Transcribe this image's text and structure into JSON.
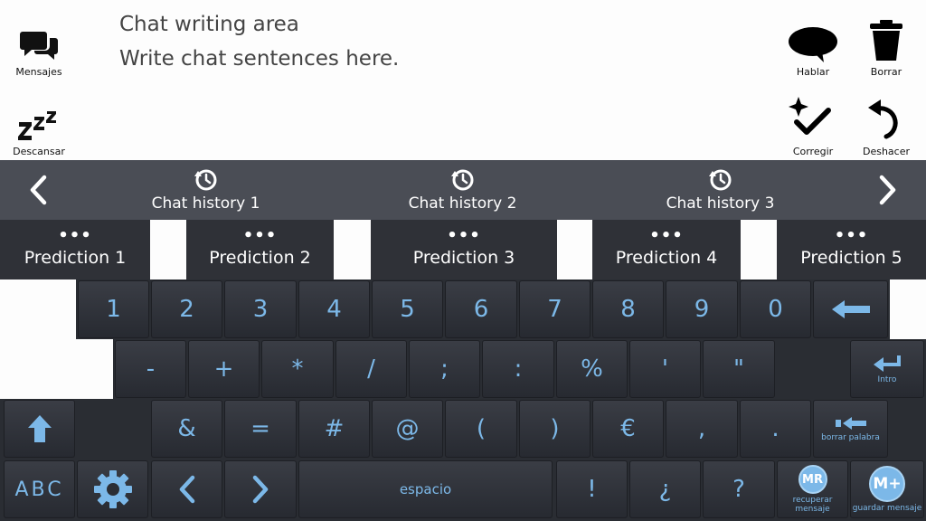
{
  "top": {
    "mensajes": "Mensajes",
    "descansar": "Descansar",
    "hablar": "Hablar",
    "borrar": "Borrar",
    "corregir": "Corregir",
    "deshacer": "Deshacer"
  },
  "chat": {
    "title": "Chat writing area",
    "placeholder": "Write chat sentences here."
  },
  "history": [
    "Chat history 1",
    "Chat history 2",
    "Chat history 3"
  ],
  "predictions": [
    "Prediction 1",
    "Prediction 2",
    "Prediction 3",
    "Prediction 4",
    "Prediction 5"
  ],
  "keyboard": {
    "row1": [
      "1",
      "2",
      "3",
      "4",
      "5",
      "6",
      "7",
      "8",
      "9",
      "0"
    ],
    "row2": [
      "-",
      "+",
      "*",
      "/",
      ";",
      ":",
      "%",
      "'",
      "\""
    ],
    "row3": [
      "&",
      "=",
      "#",
      "@",
      "(",
      ")",
      "€",
      ",",
      "."
    ],
    "row4": [
      "!",
      "¿",
      "?"
    ],
    "intro": "Intro",
    "borrar_palabra": "borrar palabra",
    "abc": "ABC",
    "espacio": "espacio",
    "mr": "MR",
    "recuperar": "recuperar mensaje",
    "mplus": "M+",
    "guardar": "guardar mensaje"
  },
  "colors": {
    "accent": "#7cb8e8",
    "key_bg": "#30333a",
    "bar_bg": "#4a4d55"
  }
}
